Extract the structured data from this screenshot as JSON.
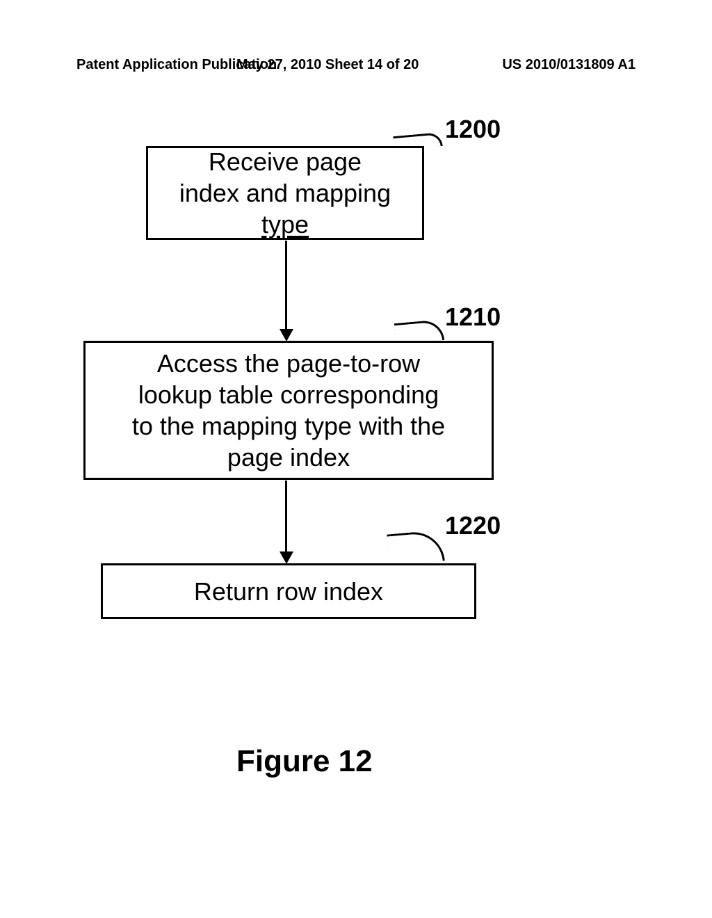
{
  "header": {
    "left": "Patent Application Publication",
    "center": "May 27, 2010  Sheet 14 of 20",
    "right": "US 2010/0131809 A1"
  },
  "diagram": {
    "boxes": {
      "b1_line1": "Receive page",
      "b1_line2": "index and mapping",
      "b1_line3": "type",
      "b2_line1": "Access the page-to-row",
      "b2_line2": "lookup table corresponding",
      "b2_line3": "to the mapping type with the",
      "b2_line4": "page index",
      "b3": "Return row index"
    },
    "refs": {
      "r1": "1200",
      "r2": "1210",
      "r3": "1220"
    }
  },
  "figure_label": "Figure 12"
}
